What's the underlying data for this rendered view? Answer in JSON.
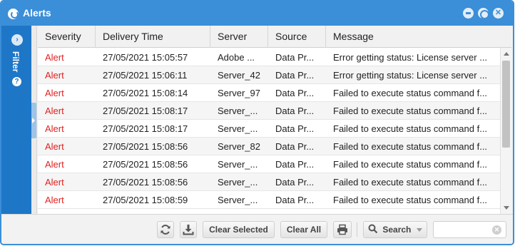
{
  "window": {
    "title": "Alerts",
    "close_glyph": "✕"
  },
  "filter": {
    "label": "Filter",
    "toggle_glyph": "›",
    "help_glyph": "?"
  },
  "columns": [
    "Severity",
    "Delivery Time",
    "Server",
    "Source",
    "Message"
  ],
  "rows": [
    {
      "severity": "Alert",
      "time": "27/05/2021 15:05:57",
      "server": "Adobe ...",
      "source": "Data Pr...",
      "message": "Error getting status: License server ..."
    },
    {
      "severity": "Alert",
      "time": "27/05/2021 15:06:11",
      "server": "Server_42",
      "source": "Data Pr...",
      "message": "Error getting status: License server ..."
    },
    {
      "severity": "Alert",
      "time": "27/05/2021 15:08:14",
      "server": "Server_97",
      "source": "Data Pr...",
      "message": "Failed to execute status command f..."
    },
    {
      "severity": "Alert",
      "time": "27/05/2021 15:08:17",
      "server": "Server_...",
      "source": "Data Pr...",
      "message": "Failed to execute status command f..."
    },
    {
      "severity": "Alert",
      "time": "27/05/2021 15:08:17",
      "server": "Server_...",
      "source": "Data Pr...",
      "message": "Failed to execute status command f..."
    },
    {
      "severity": "Alert",
      "time": "27/05/2021 15:08:56",
      "server": "Server_82",
      "source": "Data Pr...",
      "message": "Failed to execute status command f..."
    },
    {
      "severity": "Alert",
      "time": "27/05/2021 15:08:56",
      "server": "Server_...",
      "source": "Data Pr...",
      "message": "Failed to execute status command f..."
    },
    {
      "severity": "Alert",
      "time": "27/05/2021 15:08:56",
      "server": "Server_...",
      "source": "Data Pr...",
      "message": "Failed to execute status command f..."
    },
    {
      "severity": "Alert",
      "time": "27/05/2021 15:08:59",
      "server": "Server_...",
      "source": "Data Pr...",
      "message": "Failed to execute status command f..."
    }
  ],
  "toolbar": {
    "refresh_icon": "refresh-icon",
    "export_icon": "download-icon",
    "clear_selected_label": "Clear Selected",
    "clear_all_label": "Clear All",
    "print_icon": "print-icon",
    "search_label": "Search",
    "search_value": "",
    "clear_glyph": "✕"
  },
  "colors": {
    "accent": "#3b8ed8",
    "filter_panel": "#1e76c7",
    "severity_alert": "#e02020"
  }
}
